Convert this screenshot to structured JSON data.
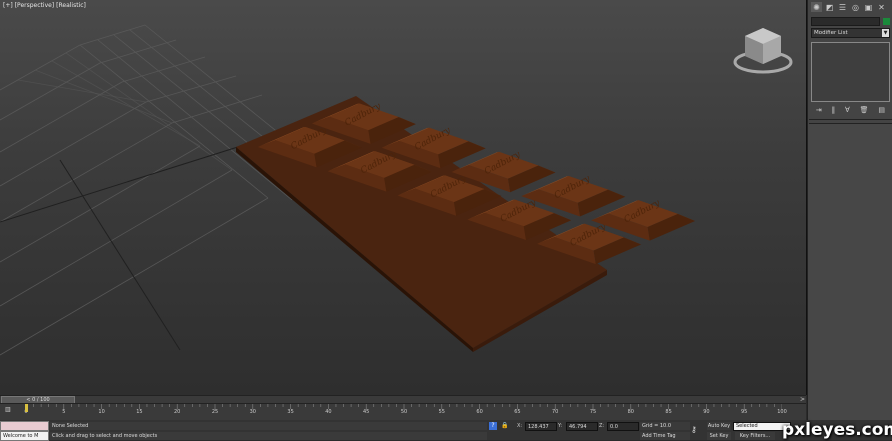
{
  "viewport": {
    "label_plus": "[+]",
    "label_view": "[Perspective]",
    "label_shading": "[Realistic]",
    "viewcube_icon": "viewcube-icon",
    "brand_logo_text": "Cadbury"
  },
  "command_panel": {
    "tabs": [
      {
        "icon": "create-icon",
        "glyph": "✺"
      },
      {
        "icon": "modify-icon",
        "glyph": "◩"
      },
      {
        "icon": "hierarchy-icon",
        "glyph": "☰"
      },
      {
        "icon": "motion-icon",
        "glyph": "◎"
      },
      {
        "icon": "display-icon",
        "glyph": "▣"
      },
      {
        "icon": "utilities-icon",
        "glyph": "✕"
      }
    ],
    "object_color": "#1b8a3b",
    "modifier_list_label": "Modifier List",
    "stack_tools": [
      {
        "icon": "pin-stack-icon",
        "glyph": "⇥"
      },
      {
        "icon": "show-end-result-icon",
        "glyph": "‖"
      },
      {
        "icon": "make-unique-icon",
        "glyph": "∀"
      },
      {
        "icon": "remove-modifier-icon",
        "glyph": "🗑"
      },
      {
        "icon": "configure-sets-icon",
        "glyph": "▤"
      }
    ]
  },
  "time_slider": {
    "position": "0 / 100",
    "left_arrow": "<",
    "right_arrow": ">"
  },
  "trackbar": {
    "labels": [
      "0",
      "5",
      "10",
      "15",
      "20",
      "25",
      "30",
      "35",
      "40",
      "45",
      "50",
      "55",
      "60",
      "65",
      "70",
      "75",
      "80",
      "85",
      "90",
      "95",
      "100"
    ]
  },
  "status": {
    "maxscript_text": "Welcome to M",
    "selection": "None Selected",
    "prompt": "Click and drag to select and move objects",
    "isolate": "?",
    "x_label": "X:",
    "x_value": "128.437",
    "y_label": "Y:",
    "y_value": "46.794",
    "z_label": "Z:",
    "z_value": "0.0",
    "grid": "Grid = 10.0",
    "add_time_tag": "Add Time Tag",
    "auto_key": "Auto Key",
    "set_key": "Set Key",
    "selected_dropdown": "Selected",
    "key_filters": "Key Filters...",
    "playback": "⏮ ◀ ▶ ▶| ⏭"
  },
  "watermark": {
    "text": "pxleyes.com"
  }
}
